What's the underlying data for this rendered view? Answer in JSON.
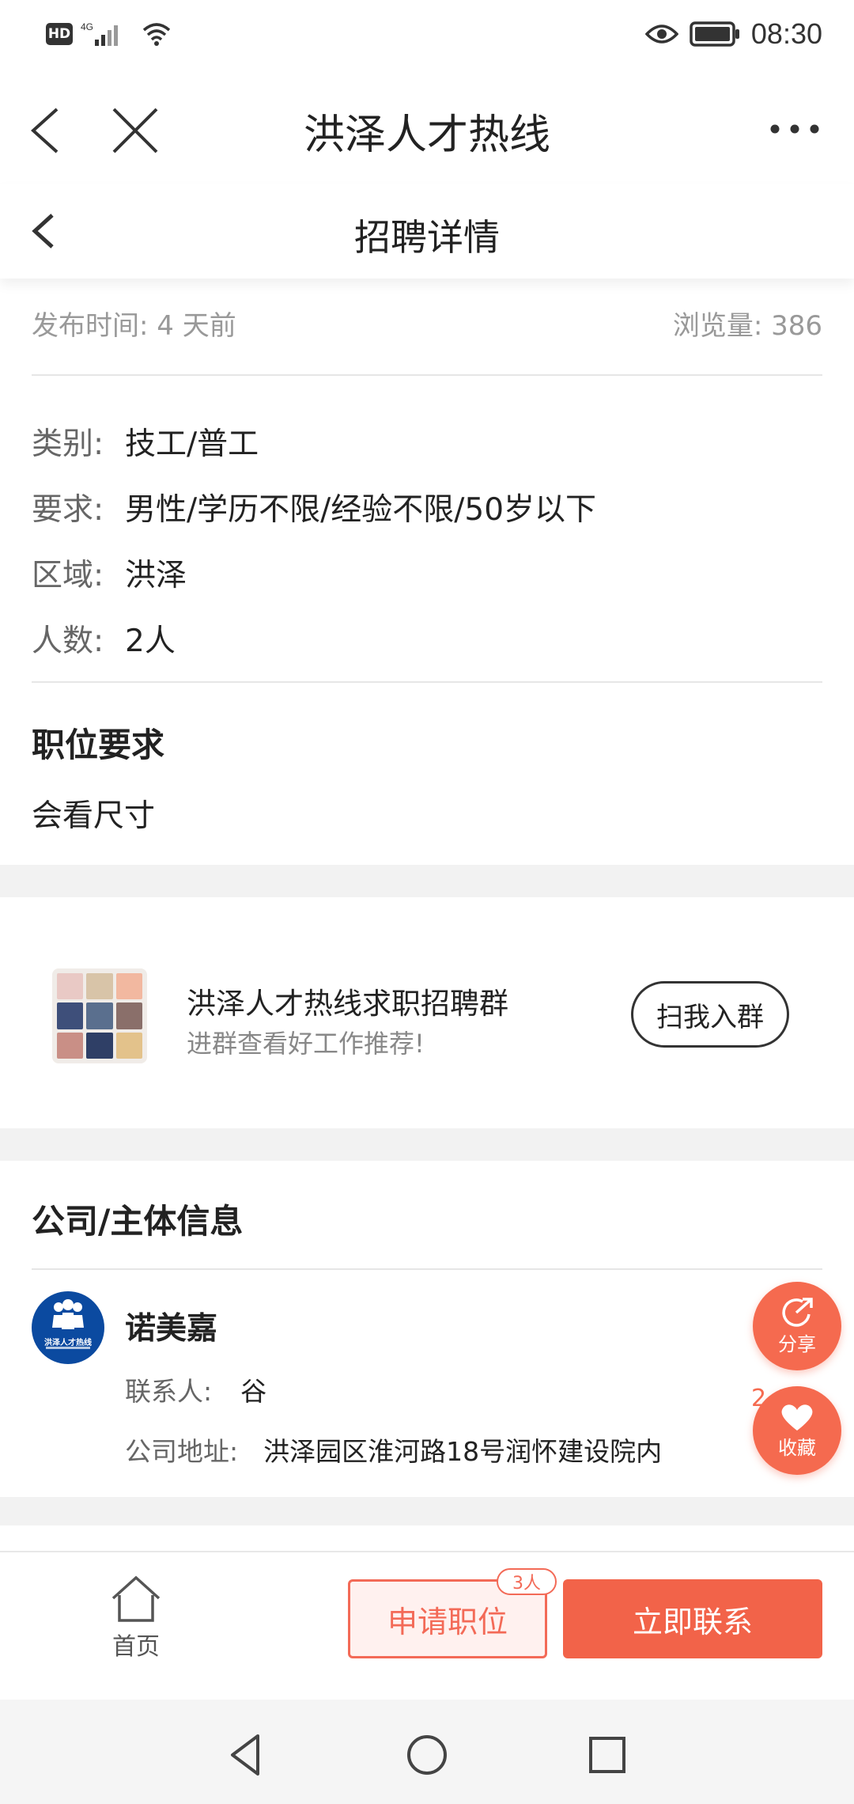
{
  "status_bar": {
    "network": "4G",
    "hd": "HD",
    "time": "08:30"
  },
  "nav": {
    "title": "洪泽人才热线"
  },
  "sub_header": {
    "title": "招聘详情"
  },
  "meta": {
    "publish_label": "发布时间: 4 天前",
    "views_label": "浏览量: 386"
  },
  "job_info": [
    {
      "label": "类别:",
      "value": "技工/普工"
    },
    {
      "label": "要求:",
      "value": "男性/学历不限/经验不限/50岁以下"
    },
    {
      "label": "区域:",
      "value": "洪泽"
    },
    {
      "label": "人数:",
      "value": "2人"
    }
  ],
  "requirements": {
    "title": "职位要求",
    "text": "会看尺寸"
  },
  "group_card": {
    "name": "洪泽人才热线求职招聘群",
    "desc": "进群查看好工作推荐!",
    "join_label": "扫我入群"
  },
  "company": {
    "section_title": "公司/主体信息",
    "avatar_text": "洪泽人才热线",
    "name": "诺美嘉",
    "contact_label": "联系人:",
    "contact_value": "谷",
    "address_label": "公司地址:",
    "address_value": "洪泽园区淮河路18号润怀建设院内"
  },
  "floating": {
    "share_label": "分享",
    "favorite_label": "收藏",
    "favorite_count": "2"
  },
  "bottom_bar": {
    "home_label": "首页",
    "apply_label": "申请职位",
    "apply_badge": "3人",
    "contact_label": "立即联系"
  },
  "colors": {
    "accent": "#f26349",
    "accent_light": "#fff1ef",
    "company_blue": "#0b4aa0"
  }
}
